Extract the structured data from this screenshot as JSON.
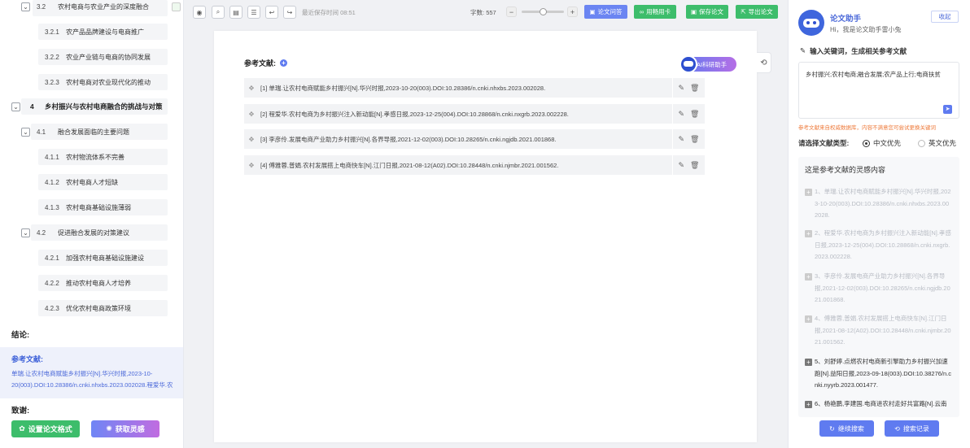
{
  "outline": {
    "items": [
      {
        "num": "3.2",
        "label": "农村电商与农业产业的深度融合",
        "level": 2
      },
      {
        "num": "3.2.1",
        "label": "农产品品牌建设与电商推广",
        "level": 3
      },
      {
        "num": "3.2.2",
        "label": "农业产业链与电商的协同发展",
        "level": 3
      },
      {
        "num": "3.2.3",
        "label": "农村电商对农业现代化的推动",
        "level": 3
      },
      {
        "num": "4",
        "label": "乡村振兴与农村电商融合的挑战与对策",
        "level": 1
      },
      {
        "num": "4.1",
        "label": "融合发展面临的主要问题",
        "level": 2
      },
      {
        "num": "4.1.1",
        "label": "农村物流体系不完善",
        "level": 3
      },
      {
        "num": "4.1.2",
        "label": "农村电商人才短缺",
        "level": 3
      },
      {
        "num": "4.1.3",
        "label": "农村电商基础设施薄弱",
        "level": 3
      },
      {
        "num": "4.2",
        "label": "促进融合发展的对策建议",
        "level": 2
      },
      {
        "num": "4.2.1",
        "label": "加强农村电商基础设施建设",
        "level": 3
      },
      {
        "num": "4.2.2",
        "label": "推动农村电商人才培养",
        "level": 3
      },
      {
        "num": "4.2.3",
        "label": "优化农村电商政策环境",
        "level": 3
      }
    ],
    "conclusion": "结论:",
    "ref_title": "参考文献:",
    "ref_preview": "单瑞.让农村电商赋能乡村振兴[N].华兴时报,2023-10-20(003).DOI:10.28386/n.cnki.nhxbs.2023.002028.程爱华.农村电商为乡村振兴注入新动能[N].李感日报",
    "thanks": "致谢:",
    "format_btn": "设置论文格式",
    "inspire_btn": "获取灵感"
  },
  "toolbar": {
    "save_time": "最近保存时间 08:51",
    "word_count_label": "字数:",
    "word_count": "557",
    "zoom_minus": "−",
    "zoom_plus": "+",
    "zoom_level": 0.5,
    "qa": "论文问答",
    "card": "用畅用卡",
    "save": "保存论文",
    "export": "导出论文"
  },
  "document": {
    "heading": "参考文献:",
    "ai_badge": "AI科研助手",
    "refs": [
      "[1] 单瑞.让农村电商赋能乡村振兴[N].华兴时报,2023-10-20(003).DOI:10.28386/n.cnki.nhxbs.2023.002028.",
      "[2] 程爱华.农村电商为乡村振兴注入新动能[N].孝感日报,2023-12-25(004).DOI:10.28868/n.cnki.nxgrb.2023.002228.",
      "[3] 李彦伶.发展电商产业助力乡村振兴[N].各界导报,2021-12-02(003).DOI:10.28265/n.cnki.ngjdb.2021.001868.",
      "[4] 傅雅蓉,普娟.农村发展搭上电商快车[N].江门日报,2021-08-12(A02).DOI:10.28448/n.cnki.njmbr.2021.001562."
    ]
  },
  "assistant": {
    "title": "论文助手",
    "greeting": "Hi，我是论文助手雷小兔",
    "collapse": "收起",
    "prompt_label": "输入关键词，生成相关参考文献",
    "keywords": "乡村振兴;农村电商;融合发展;农产品上行;电商扶贫",
    "warning": "参考文献来自权威数据库，内容不满意您可尝试更换关键词",
    "type_label": "请选择文献类型:",
    "opt_cn": "中文优先",
    "opt_en": "英文优先",
    "inspire_title": "这是参考文献的灵感内容",
    "inspirations": [
      {
        "first": "1、单瑞.让农村电商赋能乡村振兴[N].华兴时报,202",
        "rest": "3-10-20(003).DOI:10.28386/n.cnki.nhxbs.2023.00",
        "last": "2028.",
        "active": false
      },
      {
        "first": "2、程爱华.农村电商为乡村振兴注入新动能[N].孝感",
        "rest": "日报,2023-12-25(004).DOI:10.28868/n.cnki.nxgrb.",
        "last": "2023.002228.",
        "active": false
      },
      {
        "first": "3、李彦伶.发展电商产业助力乡村振兴[N].各界导",
        "rest": "报,2021-12-02(003).DOI:10.28265/n.cnki.ngjdb.20",
        "last": "21.001868.",
        "active": false
      },
      {
        "first": "4、傅雅蓉,普娟.农村发展搭上电商快车[N].江门日",
        "rest": "报,2021-08-12(A02).DOI:10.28448/n.cnki.njmbr.20",
        "last": "21.001562.",
        "active": false
      },
      {
        "first": "5、刘舒婷.点燃农村电商新引擎助力乡村振兴加速",
        "rest": "跑[N].益阳日报,2023-09-18(003).DOI:10.38276/n.c",
        "last": "nki.nyyrb.2023.001477.",
        "active": true
      },
      {
        "first": "6、杨艳鹏,李建国.电商进农村走好共富路[N].云南",
        "rest": "",
        "last": "",
        "active": true
      }
    ],
    "continue_btn": "继续搜索",
    "history_btn": "搜索记录"
  },
  "colors": {
    "primary": "#5f7bf0",
    "green": "#3dbd6b",
    "orange": "#ee7b3c"
  }
}
